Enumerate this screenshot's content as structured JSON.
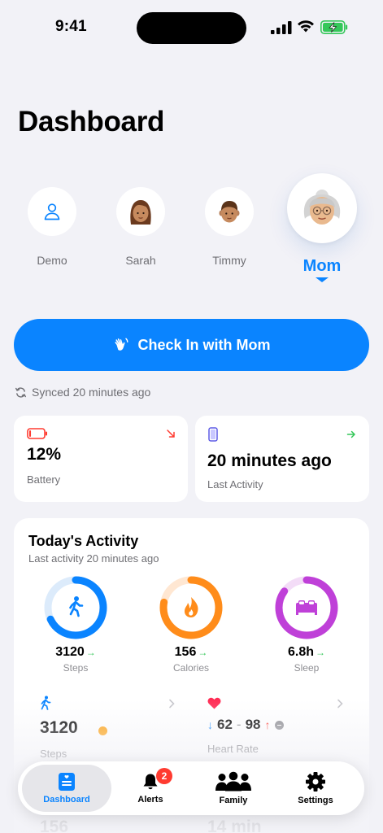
{
  "status_bar": {
    "time": "9:41"
  },
  "title": "Dashboard",
  "members": [
    {
      "name": "Demo"
    },
    {
      "name": "Sarah"
    },
    {
      "name": "Timmy"
    },
    {
      "name": "Mom"
    }
  ],
  "check_in": {
    "label": "Check In with Mom",
    "icon": "wave-hand-icon"
  },
  "synced": "Synced 20 minutes ago",
  "battery_card": {
    "value": "12%",
    "label": "Battery",
    "level": 0.12
  },
  "last_activity_card": {
    "value": "20 minutes ago",
    "label": "Last Activity"
  },
  "activity": {
    "title": "Today's Activity",
    "subtitle": "Last activity 20 minutes ago",
    "rings": [
      {
        "value": "3120",
        "label": "Steps",
        "progress": 0.68,
        "color": "#0a84ff",
        "track": "#dcebfb",
        "icon": "walking-icon"
      },
      {
        "value": "156",
        "label": "Calories",
        "progress": 0.78,
        "color": "#ff8c1a",
        "track": "#ffe7d2",
        "icon": "flame-icon"
      },
      {
        "value": "6.8h",
        "label": "Sleep",
        "progress": 0.85,
        "color": "#bf40d8",
        "track": "#f3dcf7",
        "icon": "bed-icon"
      }
    ],
    "steps_card": {
      "value": "3120",
      "label": "Steps"
    },
    "heart_card": {
      "low": "62",
      "separator": "-",
      "high": "98",
      "label": "Heart Rate"
    },
    "partial_calories": "156",
    "partial_duration": "14 min"
  },
  "tabs": [
    {
      "label": "Dashboard",
      "icon": "dashboard-icon"
    },
    {
      "label": "Alerts",
      "icon": "bell-icon",
      "badge": "2"
    },
    {
      "label": "Family",
      "icon": "family-icon"
    },
    {
      "label": "Settings",
      "icon": "gear-icon"
    }
  ],
  "colors": {
    "accent": "#0a84ff",
    "battery_low": "#ff3b30",
    "up": "#34c759",
    "heart": "#ff2d55"
  }
}
